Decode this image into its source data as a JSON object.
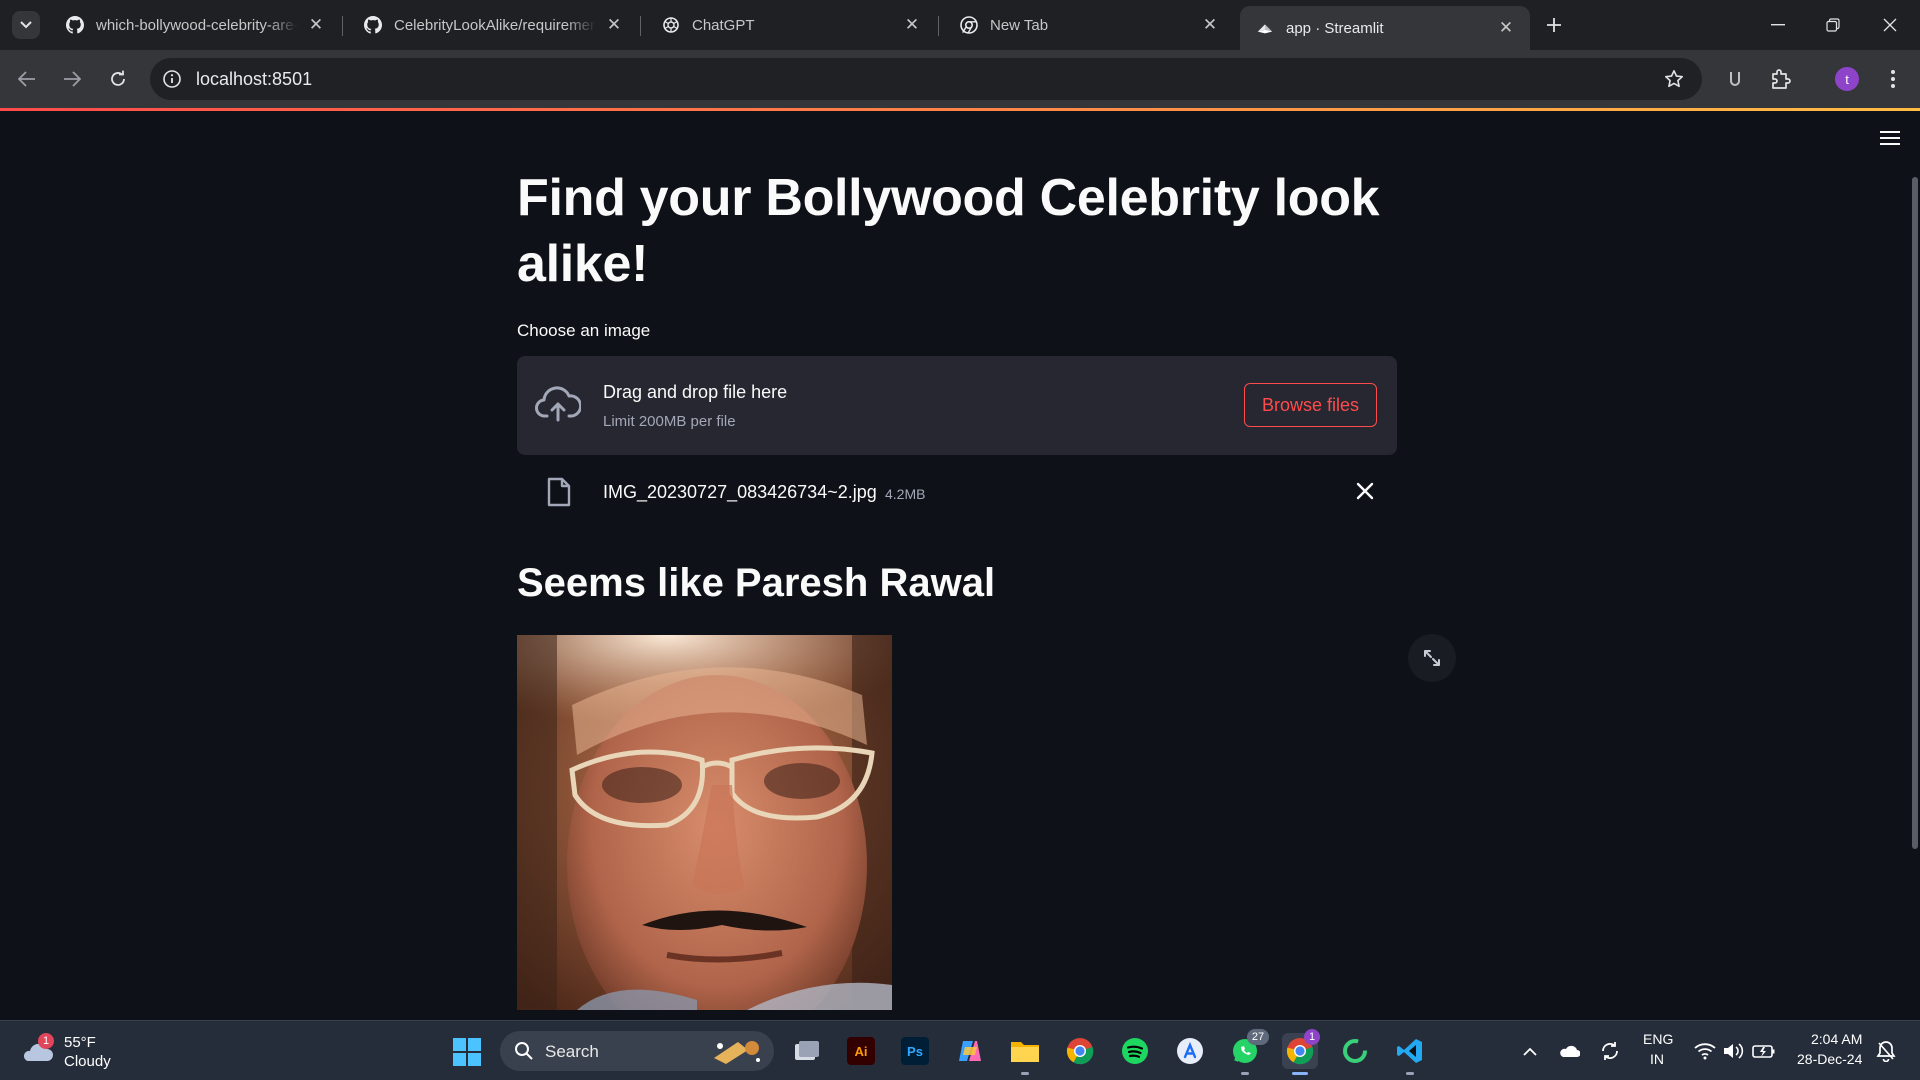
{
  "browser": {
    "tabs": [
      {
        "title": "which-bollywood-celebrity-are-",
        "favicon": "github-icon",
        "active": false
      },
      {
        "title": "CelebrityLookAlike/requirement",
        "favicon": "github-icon",
        "active": false
      },
      {
        "title": "ChatGPT",
        "favicon": "openai-icon",
        "active": false
      },
      {
        "title": "New Tab",
        "favicon": "chrome-icon",
        "active": false
      },
      {
        "title": "app · Streamlit",
        "favicon": "streamlit-icon",
        "active": true
      }
    ],
    "url": "localhost:8501",
    "profile_initial": "t",
    "accent": "#8e44c9"
  },
  "app": {
    "title": "Find your Bollywood Celebrity look alike!",
    "uploader": {
      "label": "Choose an image",
      "drop_text": "Drag and drop file here",
      "limit_text": "Limit 200MB per file",
      "browse_label": "Browse files"
    },
    "file": {
      "name": "IMG_20230727_083426734~2.jpg",
      "size": "4.2MB"
    },
    "result": "Seems like Paresh Rawal",
    "colors": {
      "primary": "#ff4b4b",
      "background": "#0e1117",
      "secondary_bg": "#262730",
      "text": "#fafafa"
    }
  },
  "taskbar": {
    "weather": {
      "temp": "55°F",
      "condition": "Cloudy",
      "badge": "1"
    },
    "search_placeholder": "Search",
    "whatsapp_count": "27",
    "chrome_badge": "1",
    "lang_line1": "ENG",
    "lang_line2": "IN",
    "time": "2:04 AM",
    "date": "28-Dec-24"
  }
}
